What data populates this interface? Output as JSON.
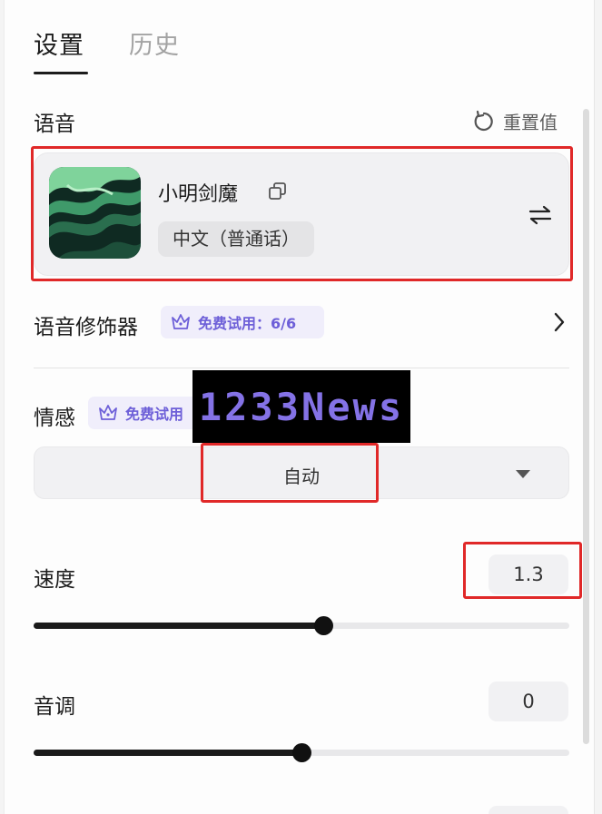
{
  "tabs": [
    {
      "label": "设置",
      "active": true
    },
    {
      "label": "历史",
      "active": false
    }
  ],
  "voice": {
    "section_label": "语音",
    "reset_label": "重置值",
    "name": "小明剑魔",
    "language": "中文（普通话）"
  },
  "modifier": {
    "label": "语音修饰器",
    "badge": "免费试用：6/6"
  },
  "emotion": {
    "label": "情感",
    "badge": "免费试用",
    "selected": "自动"
  },
  "speed": {
    "label": "速度",
    "value": "1.3",
    "fill_fraction": 0.54
  },
  "pitch": {
    "label": "音调",
    "value": "0",
    "fill_fraction": 0.5
  },
  "watermark": {
    "text": "1233News"
  },
  "colors": {
    "accent_purple": "#6d5fd8",
    "badge_bg": "#f0eefb",
    "highlight_red": "#e02828",
    "slider_fill": "#1a1a1a"
  },
  "icons": [
    "reset-icon",
    "copy-icon",
    "swap-icon",
    "crown-icon",
    "chevron-right-icon",
    "caret-down-icon"
  ]
}
